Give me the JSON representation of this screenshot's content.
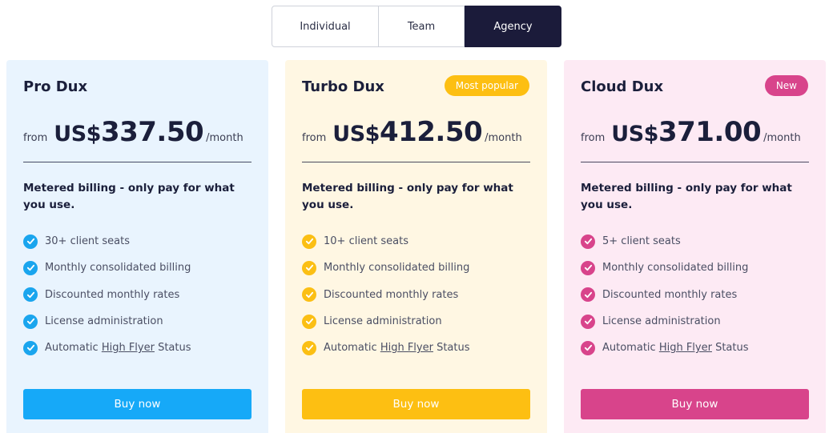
{
  "tabs": [
    {
      "label": "Individual",
      "active": false
    },
    {
      "label": "Team",
      "active": false
    },
    {
      "label": "Agency",
      "active": true
    }
  ],
  "plans": [
    {
      "name": "Pro Dux",
      "badge": "",
      "from": "from",
      "currency": "US$",
      "amount": "337.50",
      "period": "/month",
      "billing": "Metered billing - only pay for what you use.",
      "features": [
        "30+ client seats",
        "Monthly consolidated billing",
        "Discounted monthly rates",
        "License administration"
      ],
      "status_prefix": "Automatic ",
      "status_link": "High Flyer",
      "status_suffix": " Status",
      "button": "Buy now",
      "accent": "#16a9f8"
    },
    {
      "name": "Turbo Dux",
      "badge": "Most popular",
      "from": "from",
      "currency": "US$",
      "amount": "412.50",
      "period": "/month",
      "billing": "Metered billing - only pay for what you use.",
      "features": [
        "10+ client seats",
        "Monthly consolidated billing",
        "Discounted monthly rates",
        "License administration"
      ],
      "status_prefix": "Automatic ",
      "status_link": "High Flyer",
      "status_suffix": " Status",
      "button": "Buy now",
      "accent": "#fdbf12"
    },
    {
      "name": "Cloud Dux",
      "badge": "New",
      "from": "from",
      "currency": "US$",
      "amount": "371.00",
      "period": "/month",
      "billing": "Metered billing - only pay for what you use.",
      "features": [
        "5+ client seats",
        "Monthly consolidated billing",
        "Discounted monthly rates",
        "License administration"
      ],
      "status_prefix": "Automatic ",
      "status_link": "High Flyer",
      "status_suffix": " Status",
      "button": "Buy now",
      "accent": "#d8448b"
    }
  ]
}
